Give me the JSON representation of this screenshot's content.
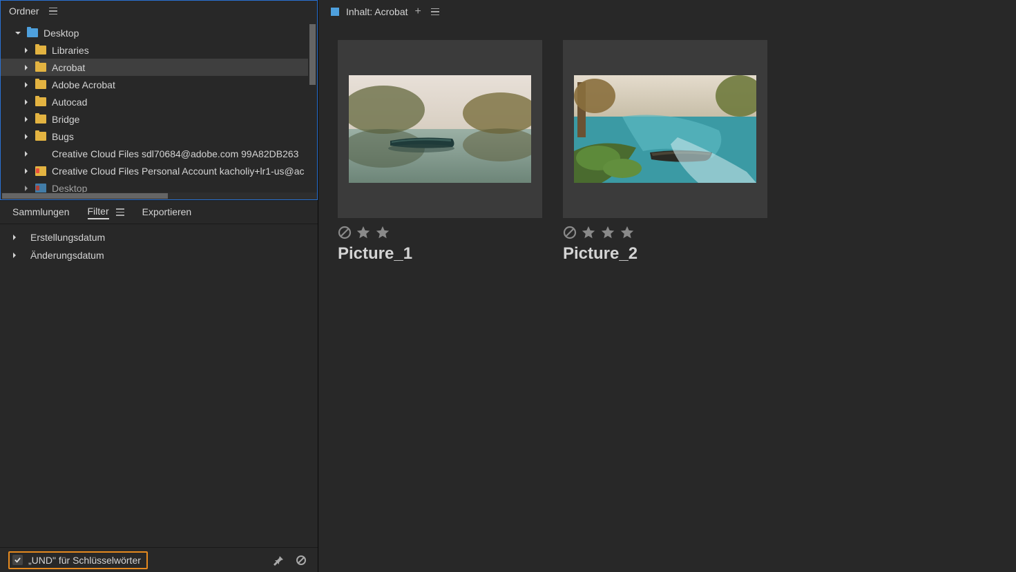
{
  "left": {
    "title": "Ordner",
    "tree": {
      "root": "Desktop",
      "items": [
        {
          "label": "Libraries",
          "icon": "yellow"
        },
        {
          "label": "Acrobat",
          "icon": "yellow",
          "selected": true
        },
        {
          "label": "Adobe Acrobat",
          "icon": "yellow"
        },
        {
          "label": "Autocad",
          "icon": "yellow"
        },
        {
          "label": "Bridge",
          "icon": "yellow"
        },
        {
          "label": "Bugs",
          "icon": "yellow"
        },
        {
          "label": "Creative Cloud Files  sdl70684@adobe.com 99A82DB263",
          "icon": "none"
        },
        {
          "label": "Creative Cloud Files Personal Account kacholiy+lr1-us@ac",
          "icon": "cc-yellow"
        },
        {
          "label": "Desktop",
          "icon": "cc-blue",
          "partial": true
        }
      ]
    },
    "midTabs": {
      "collections": "Sammlungen",
      "filter": "Filter",
      "export": "Exportieren"
    },
    "filters": [
      "Erstellungsdatum",
      "Änderungsdatum"
    ],
    "bottom": {
      "und": "„UND\" für Schlüsselwörter"
    }
  },
  "right": {
    "header": "Inhalt: Acrobat",
    "items": [
      {
        "name": "Picture_1",
        "stars": 2,
        "bg1": "#aec3c0",
        "bg2": "#435848"
      },
      {
        "name": "Picture_2",
        "stars": 3,
        "bg1": "#8fa38e",
        "bg2": "#3aa7b0"
      }
    ]
  }
}
